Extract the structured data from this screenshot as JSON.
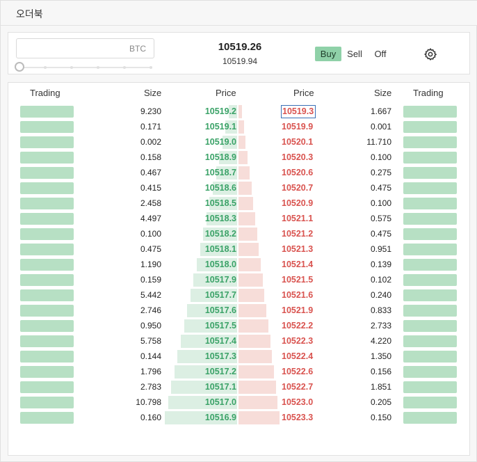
{
  "window_title": "오더북",
  "order_form": {
    "amount_value": "",
    "amount_unit": "BTC",
    "last_price": "10519.26",
    "mark_price": "10519.94",
    "modes": [
      "Buy",
      "Sell",
      "Off"
    ],
    "active_mode": "Buy",
    "settings_icon": "gear-icon"
  },
  "order_book": {
    "headers": {
      "trading_left": "Trading",
      "bid_size": "Size",
      "bid_price": "Price",
      "ask_price": "Price",
      "ask_size": "Size",
      "trading_right": "Trading"
    },
    "highlighted_ask_index": 0,
    "rows": [
      {
        "bid_size": "9.230",
        "bid_price": "10519.2",
        "ask_price": "10519.3",
        "ask_size": "1.667"
      },
      {
        "bid_size": "0.171",
        "bid_price": "10519.1",
        "ask_price": "10519.9",
        "ask_size": "0.001"
      },
      {
        "bid_size": "0.002",
        "bid_price": "10519.0",
        "ask_price": "10520.1",
        "ask_size": "11.710"
      },
      {
        "bid_size": "0.158",
        "bid_price": "10518.9",
        "ask_price": "10520.3",
        "ask_size": "0.100"
      },
      {
        "bid_size": "0.467",
        "bid_price": "10518.7",
        "ask_price": "10520.6",
        "ask_size": "0.275"
      },
      {
        "bid_size": "0.415",
        "bid_price": "10518.6",
        "ask_price": "10520.7",
        "ask_size": "0.475"
      },
      {
        "bid_size": "2.458",
        "bid_price": "10518.5",
        "ask_price": "10520.9",
        "ask_size": "0.100"
      },
      {
        "bid_size": "4.497",
        "bid_price": "10518.3",
        "ask_price": "10521.1",
        "ask_size": "0.575"
      },
      {
        "bid_size": "0.100",
        "bid_price": "10518.2",
        "ask_price": "10521.2",
        "ask_size": "0.475"
      },
      {
        "bid_size": "0.475",
        "bid_price": "10518.1",
        "ask_price": "10521.3",
        "ask_size": "0.951"
      },
      {
        "bid_size": "1.190",
        "bid_price": "10518.0",
        "ask_price": "10521.4",
        "ask_size": "0.139"
      },
      {
        "bid_size": "0.159",
        "bid_price": "10517.9",
        "ask_price": "10521.5",
        "ask_size": "0.102"
      },
      {
        "bid_size": "5.442",
        "bid_price": "10517.7",
        "ask_price": "10521.6",
        "ask_size": "0.240"
      },
      {
        "bid_size": "2.746",
        "bid_price": "10517.6",
        "ask_price": "10521.9",
        "ask_size": "0.833"
      },
      {
        "bid_size": "0.950",
        "bid_price": "10517.5",
        "ask_price": "10522.2",
        "ask_size": "2.733"
      },
      {
        "bid_size": "5.758",
        "bid_price": "10517.4",
        "ask_price": "10522.3",
        "ask_size": "4.220"
      },
      {
        "bid_size": "0.144",
        "bid_price": "10517.3",
        "ask_price": "10522.4",
        "ask_size": "1.350"
      },
      {
        "bid_size": "1.796",
        "bid_price": "10517.2",
        "ask_price": "10522.6",
        "ask_size": "0.156"
      },
      {
        "bid_size": "2.783",
        "bid_price": "10517.1",
        "ask_price": "10522.7",
        "ask_size": "1.851"
      },
      {
        "bid_size": "10.798",
        "bid_price": "10517.0",
        "ask_price": "10523.0",
        "ask_size": "0.205"
      },
      {
        "bid_size": "0.160",
        "bid_price": "10516.9",
        "ask_price": "10523.3",
        "ask_size": "0.150"
      }
    ]
  }
}
